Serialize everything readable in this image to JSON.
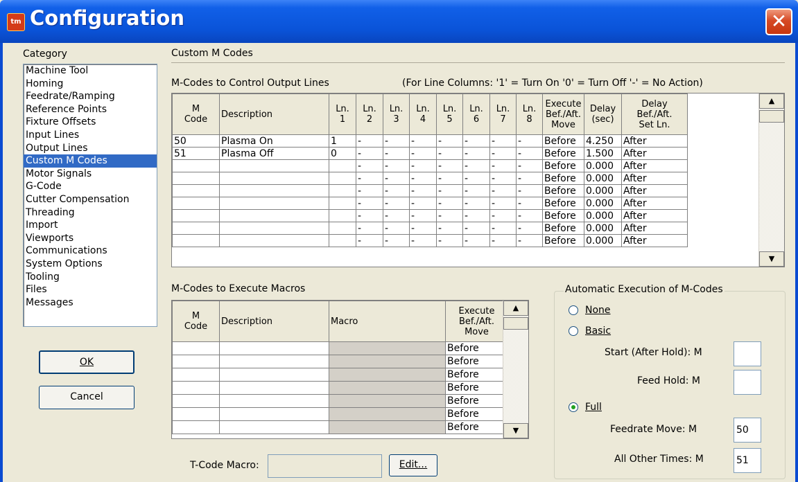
{
  "window": {
    "title": "Configuration",
    "title_icon": "app-icon",
    "close_label": "✕"
  },
  "category": {
    "label": "Category",
    "items": [
      "Machine Tool",
      "Homing",
      "Feedrate/Ramping",
      "Reference Points",
      "Fixture Offsets",
      "Input Lines",
      "Output Lines",
      "Custom M Codes",
      "Motor Signals",
      "G-Code",
      "Cutter Compensation",
      "Threading",
      "Import",
      "Viewports",
      "Communications",
      "System Options",
      "Tooling",
      "Files",
      "Messages"
    ],
    "selected_index": 7
  },
  "buttons": {
    "ok": "OK",
    "cancel": "Cancel",
    "edit": "Edit..."
  },
  "section_title": "Custom M Codes",
  "output_lines": {
    "label": "M-Codes to Control Output Lines",
    "legend": "(For Line Columns:  '1' = Turn On   '0' = Turn Off   '-' = No Action)",
    "headers": [
      "M\nCode",
      "Description",
      "Ln.\n1",
      "Ln.\n2",
      "Ln.\n3",
      "Ln.\n4",
      "Ln.\n5",
      "Ln.\n6",
      "Ln.\n7",
      "Ln.\n8",
      "Execute\nBef./Aft.\nMove",
      "Delay\n(sec)",
      "Delay\nBef./Aft.\nSet Ln."
    ],
    "rows": [
      [
        "50",
        "Plasma On",
        "1",
        "-",
        "-",
        "-",
        "-",
        "-",
        "-",
        "-",
        "Before",
        "4.250",
        "After"
      ],
      [
        "51",
        "Plasma Off",
        "0",
        "-",
        "-",
        "-",
        "-",
        "-",
        "-",
        "-",
        "Before",
        "1.500",
        "After"
      ],
      [
        "",
        "",
        "",
        "-",
        "-",
        "-",
        "-",
        "-",
        "-",
        "-",
        "Before",
        "0.000",
        "After"
      ],
      [
        "",
        "",
        "",
        "-",
        "-",
        "-",
        "-",
        "-",
        "-",
        "-",
        "Before",
        "0.000",
        "After"
      ],
      [
        "",
        "",
        "",
        "-",
        "-",
        "-",
        "-",
        "-",
        "-",
        "-",
        "Before",
        "0.000",
        "After"
      ],
      [
        "",
        "",
        "",
        "-",
        "-",
        "-",
        "-",
        "-",
        "-",
        "-",
        "Before",
        "0.000",
        "After"
      ],
      [
        "",
        "",
        "",
        "-",
        "-",
        "-",
        "-",
        "-",
        "-",
        "-",
        "Before",
        "0.000",
        "After"
      ],
      [
        "",
        "",
        "",
        "-",
        "-",
        "-",
        "-",
        "-",
        "-",
        "-",
        "Before",
        "0.000",
        "After"
      ],
      [
        "",
        "",
        "",
        "-",
        "-",
        "-",
        "-",
        "-",
        "-",
        "-",
        "Before",
        "0.000",
        "After"
      ]
    ]
  },
  "macros": {
    "label": "M-Codes to Execute Macros",
    "headers": [
      "M\nCode",
      "Description",
      "Macro",
      "Execute\nBef./Aft.\nMove"
    ],
    "rows": [
      [
        "",
        "",
        "",
        "Before"
      ],
      [
        "",
        "",
        "",
        "Before"
      ],
      [
        "",
        "",
        "",
        "Before"
      ],
      [
        "",
        "",
        "",
        "Before"
      ],
      [
        "",
        "",
        "",
        "Before"
      ],
      [
        "",
        "",
        "",
        "Before"
      ],
      [
        "",
        "",
        "",
        "Before"
      ]
    ]
  },
  "tcode": {
    "label": "T-Code Macro:",
    "value": ""
  },
  "auto_exec": {
    "legend": "Automatic Execution of M-Codes",
    "none_label": "None",
    "basic_label": "Basic",
    "full_label": "Full",
    "selected": "Full",
    "start_label": "Start (After Hold):  M",
    "start_value": "",
    "feedhold_label": "Feed Hold:  M",
    "feedhold_value": "",
    "feedrate_label": "Feedrate Move:  M",
    "feedrate_value": "50",
    "other_label": "All Other Times:  M",
    "other_value": "51"
  },
  "colors": {
    "titlebar": "#0a53d8",
    "selection": "#316ac5",
    "dialog_bg": "#ece9d8"
  }
}
